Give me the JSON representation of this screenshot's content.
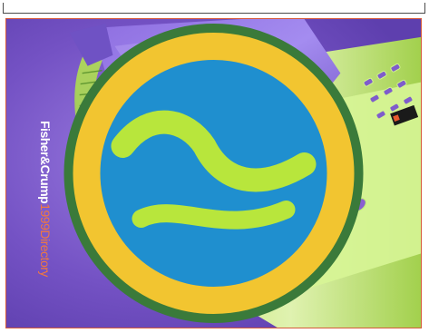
{
  "page": {
    "cover": {
      "brand_name": "Fisher&Crump",
      "edition_label": "1999Directory",
      "logo": "globe-logo-icon",
      "background_subject": "telephone-photo",
      "colors": {
        "background": "#7a55c8",
        "accent_green": "#b8e63c",
        "border": "#d65a3a",
        "edition_text": "#f07840"
      }
    }
  }
}
